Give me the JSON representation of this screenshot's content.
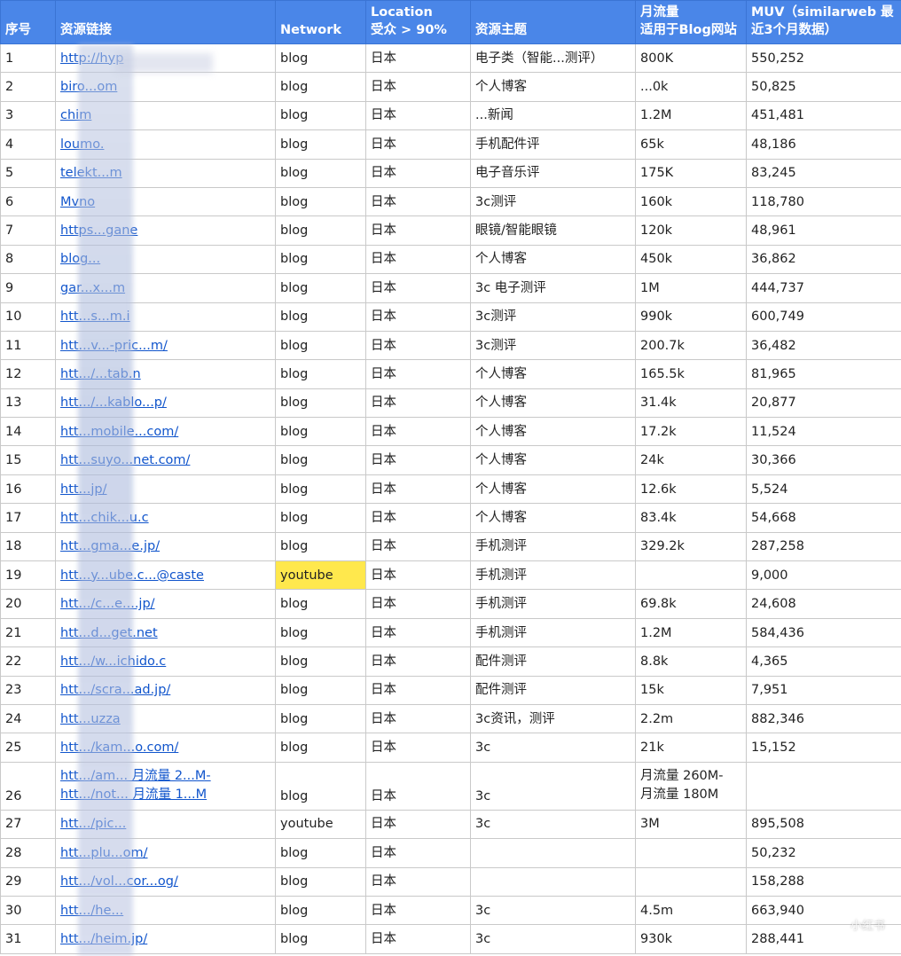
{
  "headers": {
    "index": "序号",
    "link": "资源链接",
    "network": "Network",
    "location_line1": "Location",
    "location_line2": "受众 > 90%",
    "topic": "资源主题",
    "traffic_line1": "月流量",
    "traffic_line2": "适用于Blog网站",
    "muv_line1": "MUV（similarweb 最",
    "muv_line2": "近3个月数据）"
  },
  "rows": [
    {
      "idx": "1",
      "link": "http://hyp",
      "network": "blog",
      "location": "日本",
      "topic": "电子类（智能...测评）",
      "traffic": "800K",
      "muv": "550,252"
    },
    {
      "idx": "2",
      "link": "biro...om",
      "network": "blog",
      "location": "日本",
      "topic": "个人博客",
      "traffic": "...0k",
      "muv": "50,825"
    },
    {
      "idx": "3",
      "link": "chim",
      "network": "blog",
      "location": "日本",
      "topic": "...新闻",
      "traffic": "1.2M",
      "muv": "451,481"
    },
    {
      "idx": "4",
      "link": "loumo.",
      "network": "blog",
      "location": "日本",
      "topic": "手机配件评",
      "traffic": "65k",
      "muv": "48,186"
    },
    {
      "idx": "5",
      "link": "telekt...m",
      "network": "blog",
      "location": "日本",
      "topic": "电子音乐评",
      "traffic": "175K",
      "muv": "83,245"
    },
    {
      "idx": "6",
      "link": "Mvno",
      "network": "blog",
      "location": "日本",
      "topic": "3c测评",
      "traffic": "160k",
      "muv": "118,780"
    },
    {
      "idx": "7",
      "link": "https...gane",
      "network": "blog",
      "location": "日本",
      "topic": "眼镜/智能眼镜",
      "traffic": "120k",
      "muv": "48,961"
    },
    {
      "idx": "8",
      "link": "blog...",
      "network": "blog",
      "location": "日本",
      "topic": "个人博客",
      "traffic": "450k",
      "muv": "36,862"
    },
    {
      "idx": "9",
      "link": "gar...x...m",
      "network": "blog",
      "location": "日本",
      "topic": "3c 电子测评",
      "traffic": "1M",
      "muv": "444,737"
    },
    {
      "idx": "10",
      "link": "htt...s...m.i",
      "network": "blog",
      "location": "日本",
      "topic": "3c测评",
      "traffic": "990k",
      "muv": "600,749"
    },
    {
      "idx": "11",
      "link": "htt...v...-pric...m/",
      "network": "blog",
      "location": "日本",
      "topic": "3c测评",
      "traffic": "200.7k",
      "muv": "36,482"
    },
    {
      "idx": "12",
      "link": "htt.../...tab.n",
      "network": "blog",
      "location": "日本",
      "topic": "个人博客",
      "traffic": "165.5k",
      "muv": "81,965"
    },
    {
      "idx": "13",
      "link": "htt.../...kablo...p/",
      "network": "blog",
      "location": "日本",
      "topic": "个人博客",
      "traffic": "31.4k",
      "muv": "20,877"
    },
    {
      "idx": "14",
      "link": "htt...mobile...com/",
      "network": "blog",
      "location": "日本",
      "topic": "个人博客",
      "traffic": "17.2k",
      "muv": "11,524"
    },
    {
      "idx": "15",
      "link": "htt...suyo...net.com/",
      "network": "blog",
      "location": "日本",
      "topic": "个人博客",
      "traffic": "24k",
      "muv": "30,366"
    },
    {
      "idx": "16",
      "link": "htt...jp/",
      "network": "blog",
      "location": "日本",
      "topic": "个人博客",
      "traffic": "12.6k",
      "muv": "5,524"
    },
    {
      "idx": "17",
      "link": "htt...chik...u.c",
      "network": "blog",
      "location": "日本",
      "topic": "个人博客",
      "traffic": "83.4k",
      "muv": "54,668"
    },
    {
      "idx": "18",
      "link": "htt...gma...e.jp/",
      "network": "blog",
      "location": "日本",
      "topic": "手机测评",
      "traffic": "329.2k",
      "muv": "287,258"
    },
    {
      "idx": "19",
      "link": "htt...y...ube.c...@caste",
      "network": "youtube",
      "location": "日本",
      "topic": "手机测评",
      "traffic": "",
      "muv": "9,000"
    },
    {
      "idx": "20",
      "link": "htt.../c...e....jp/",
      "network": "blog",
      "location": "日本",
      "topic": "手机测评",
      "traffic": "69.8k",
      "muv": "24,608"
    },
    {
      "idx": "21",
      "link": "htt...d...get.net",
      "network": "blog",
      "location": "日本",
      "topic": "手机测评",
      "traffic": "1.2M",
      "muv": "584,436"
    },
    {
      "idx": "22",
      "link": "htt.../w...ichido.c",
      "network": "blog",
      "location": "日本",
      "topic": "配件测评",
      "traffic": "8.8k",
      "muv": "4,365"
    },
    {
      "idx": "23",
      "link": "htt.../scra...ad.jp/",
      "network": "blog",
      "location": "日本",
      "topic": "配件测评",
      "traffic": "15k",
      "muv": "7,951"
    },
    {
      "idx": "24",
      "link": "htt...uzza",
      "network": "blog",
      "location": "日本",
      "topic": "3c资讯，测评",
      "traffic": "2.2m",
      "muv": "882,346"
    },
    {
      "idx": "25",
      "link": "htt.../kam...o.com/",
      "network": "blog",
      "location": "日本",
      "topic": "3c",
      "traffic": "21k",
      "muv": "15,152"
    },
    {
      "idx": "27",
      "link": "htt.../pic...",
      "network": "youtube",
      "location": "日本",
      "topic": "3c",
      "traffic": "3M",
      "muv": "895,508"
    },
    {
      "idx": "28",
      "link": "htt...plu...om/",
      "network": "blog",
      "location": "日本",
      "topic": "",
      "traffic": "",
      "muv": "50,232"
    },
    {
      "idx": "29",
      "link": "htt.../vol...cor...og/",
      "network": "blog",
      "location": "日本",
      "topic": "",
      "traffic": "",
      "muv": "158,288"
    },
    {
      "idx": "30",
      "link": "htt.../he...",
      "network": "blog",
      "location": "日本",
      "topic": "3c",
      "traffic": "4.5m",
      "muv": "663,940"
    },
    {
      "idx": "31",
      "link": "htt.../heim.jp/",
      "network": "blog",
      "location": "日本",
      "topic": "3c",
      "traffic": "930k",
      "muv": "288,441"
    }
  ],
  "row26": {
    "idx": "26",
    "link_line1": "htt.../am...  月流量 2...M-",
    "link_line2": "htt.../not...  月流量 1...M",
    "network": "blog",
    "location": "日本",
    "topic": "3c",
    "traffic_line1": "月流量 260M-",
    "traffic_line2": "月流量 180M",
    "muv": ""
  },
  "watermark": "小红书"
}
